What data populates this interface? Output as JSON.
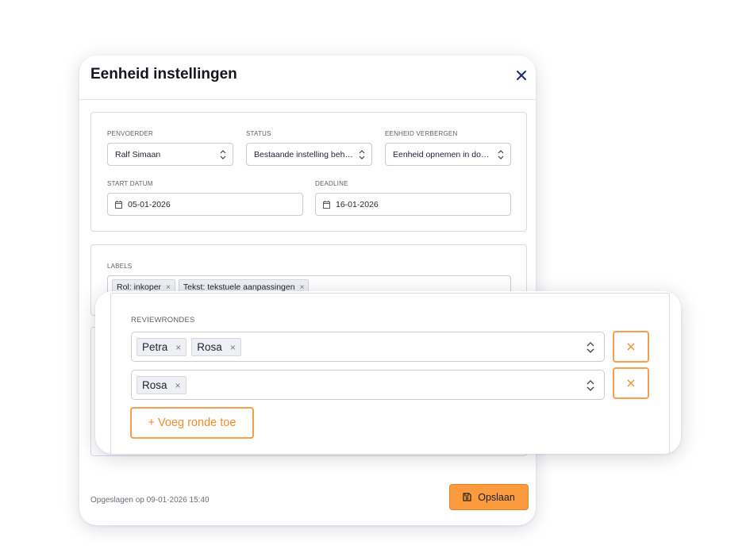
{
  "modal": {
    "title": "Eenheid instellingen",
    "fields": {
      "penvoerder": {
        "label": "PENVOERDER",
        "value": "Ralf Simaan"
      },
      "status": {
        "label": "STATUS",
        "value": "Bestaande instelling beh…"
      },
      "verbergen": {
        "label": "EENHEID VERBERGEN",
        "value": "Eenheid opnemen in do…"
      },
      "start": {
        "label": "START DATUM",
        "value": "05-01-2026"
      },
      "deadline": {
        "label": "DEADLINE",
        "value": "16-01-2026"
      }
    },
    "labels": {
      "label": "LABELS",
      "tags": [
        "Rol: inkoper",
        "Tekst: tekstuele aanpassingen"
      ]
    },
    "footer": {
      "saved_text": "Opgeslagen op 09-01-2026 15:40",
      "save_label": "Opslaan"
    }
  },
  "review": {
    "label": "REVIEWRONDES",
    "rounds": [
      [
        "Petra",
        "Rosa"
      ],
      [
        "Rosa"
      ]
    ],
    "add_label": "+ Voeg ronde toe"
  },
  "colors": {
    "accent": "#fb9b3e",
    "accent_border": "#f6a04d",
    "close_icon": "#1d2a6b"
  },
  "icons": {
    "close": "close-icon",
    "select": "chevron-up-down-icon",
    "date": "calendar-icon",
    "save": "floppy-disk-icon",
    "remove": "close-icon"
  }
}
